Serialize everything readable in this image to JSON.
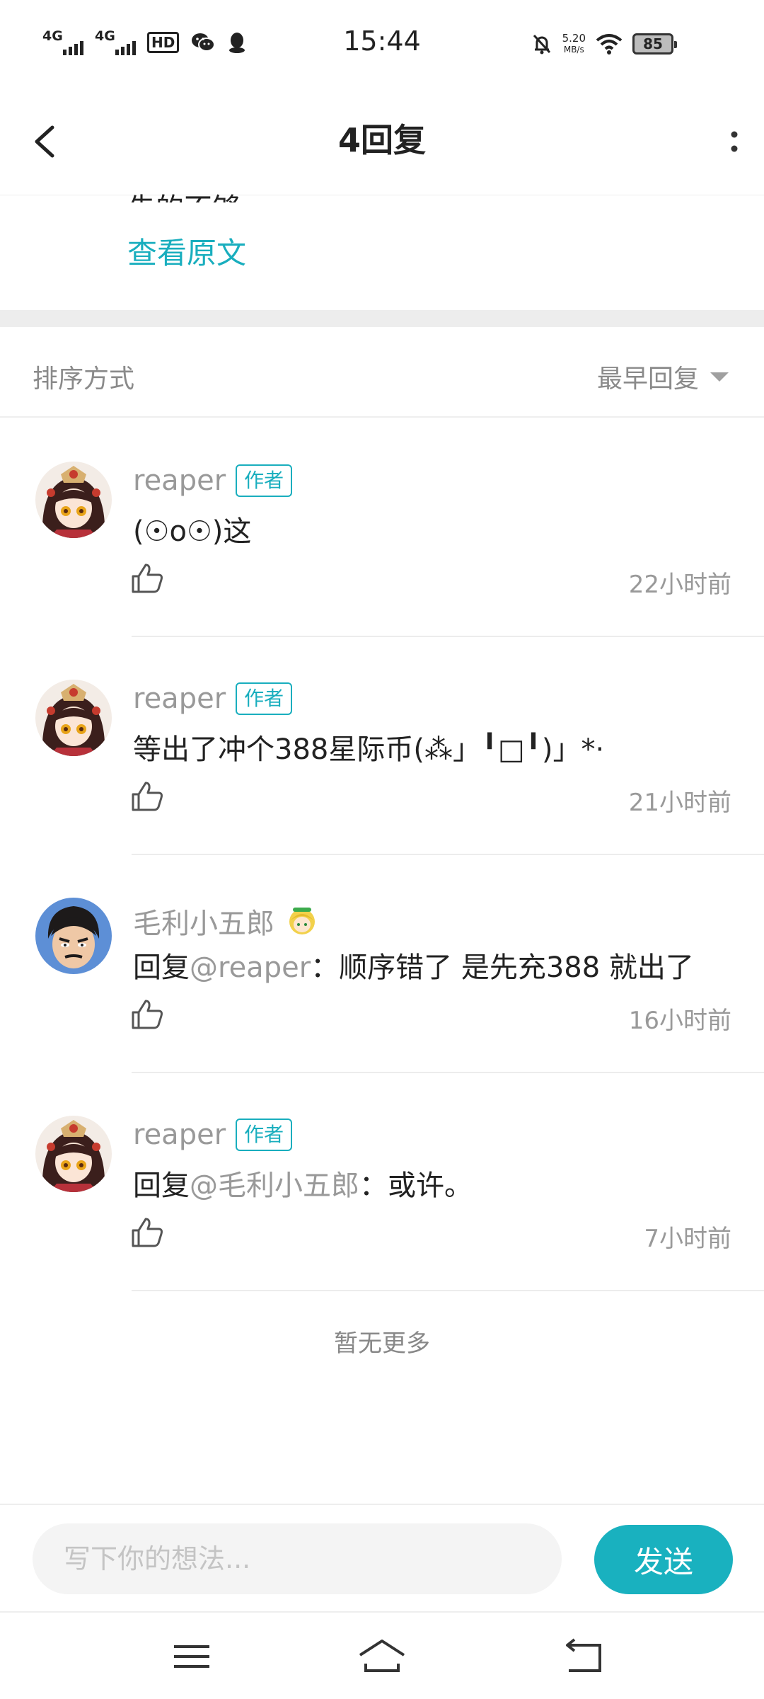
{
  "status_bar": {
    "time": "15:44",
    "signal_1": "4G",
    "signal_2": "4G",
    "hd_label": "HD",
    "net_speed_value": "5.20",
    "net_speed_unit": "MB/s",
    "battery": "85",
    "icons": [
      "wechat-icon",
      "qq-icon",
      "bell-off-icon",
      "wifi-icon"
    ]
  },
  "header": {
    "title": "4回复",
    "back_icon": "chevron-left-icon",
    "more_icon": "more-vertical-icon"
  },
  "original_post": {
    "snippet": "先的不够",
    "view_original": "查看原文"
  },
  "sort": {
    "label": "排序方式",
    "selected": "最早回复"
  },
  "comments": [
    {
      "name": "reaper",
      "badge": "作者",
      "text": "(☉o☉)这",
      "time": "22小时前",
      "avatar": "anime-girl-avatar"
    },
    {
      "name": "reaper",
      "badge": "作者",
      "text": "等出了冲个388星际币(⁂」╹□╹)」*·",
      "time": "21小时前",
      "avatar": "anime-girl-avatar"
    },
    {
      "name": "毛利小五郎",
      "text_prefix": "回复",
      "mention": "@reaper",
      "text_suffix": "：顺序错了 是先充388 就出了",
      "time": "16小时前",
      "avatar": "detective-avatar"
    },
    {
      "name": "reaper",
      "badge": "作者",
      "text_prefix": "回复",
      "mention": "@毛利小五郎",
      "text_suffix": "：或许。",
      "time": "7小时前",
      "avatar": "anime-girl-avatar"
    }
  ],
  "no_more": "暂无更多",
  "input": {
    "placeholder": "写下你的想法...",
    "send": "发送"
  },
  "colors": {
    "accent": "#19b1bf",
    "secondary_text": "#999999",
    "primary_text": "#222222"
  }
}
